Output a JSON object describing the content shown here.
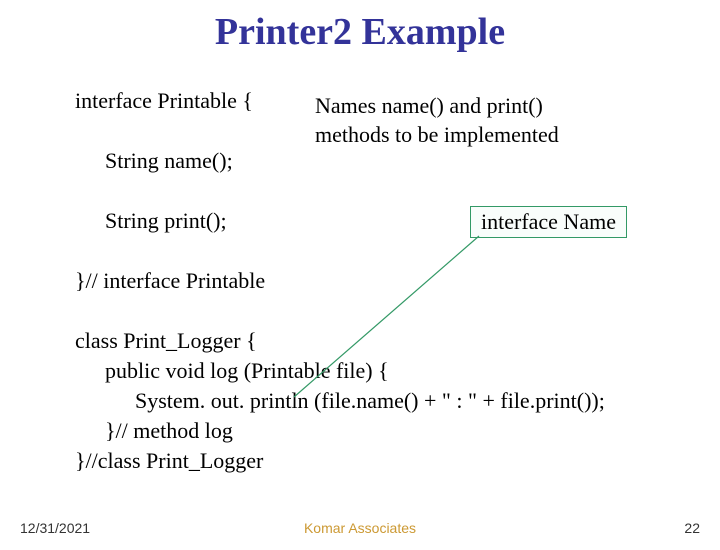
{
  "title": "Printer2 Example",
  "code": {
    "l1": "interface Printable {",
    "l2": "String name();",
    "l3": "String print();",
    "l4": "}// interface Printable",
    "l5": "class Print_Logger {",
    "l6": "public void log (Printable file) {",
    "l7": "System. out. println (file.name() + \" : \" + file.print());",
    "l8": "}// method log",
    "l9": "}//class Print_Logger"
  },
  "annotation": {
    "note": "Names name() and print() methods to be implemented",
    "box": "interface Name"
  },
  "footer": {
    "date": "12/31/2021",
    "center": "Komar Associates",
    "page": "22"
  }
}
